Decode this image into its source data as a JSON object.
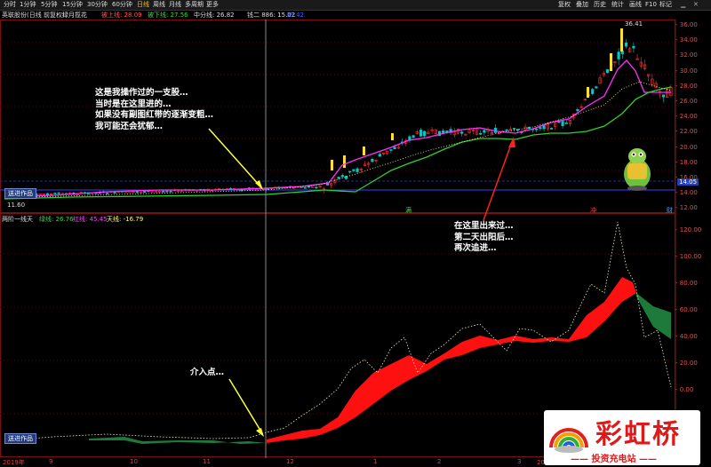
{
  "toolbar": {
    "tabs": [
      "分时",
      "1分钟",
      "5分钟",
      "15分钟",
      "30分钟",
      "60分钟",
      "日线",
      "周线",
      "月线",
      "多周期",
      "更多"
    ],
    "right_buttons": [
      "复权",
      "叠加",
      "历史",
      "统计",
      "画线",
      "F10",
      "标记"
    ]
  },
  "infobar": {
    "stock_name": "英联股份(日线 前复权)",
    "indicator_name": "绿月揽花",
    "up_label": "被上线: 28.09",
    "down_label": "被下线: 27.56",
    "mid_label": "中分线: 26.82",
    "extra_label": "钱二 886: 15.02",
    "extra_value": "39.42"
  },
  "main_chart": {
    "axis": [
      "36.00",
      "34.00",
      "32.00",
      "30.00",
      "28.00",
      "26.00",
      "24.00",
      "22.00",
      "20.00",
      "18.00",
      "16.00",
      "14.00",
      "12.00"
    ],
    "high_label": "36.41",
    "low_label": "11.60",
    "price_tag": "14.05"
  },
  "sub_chart": {
    "name": "两阶一线天",
    "green_label": "绿线: 26.76",
    "red_label": "红线: 45.45",
    "sky_label": "天线: -16.79",
    "axis": [
      "120.00",
      "100.00",
      "80.00",
      "60.00",
      "40.00",
      "20.00",
      "0.00",
      "-20.00"
    ]
  },
  "annotations": {
    "op1": "这是我操作过的一支股…",
    "op2": "当时是在这里进的…",
    "op3": "如果没有副图红带的逐渐变粗…",
    "op4": "我可能还会犹郁…",
    "rt1": "在这里出来过…",
    "rt2": "第二天出阳后…",
    "rt3": "再次追进…",
    "entry": "介入点…"
  },
  "badges": {
    "top": "送进作品",
    "bottom": "送进作品"
  },
  "xaxis": [
    "2019年",
    "9",
    "10",
    "11",
    "12",
    "1",
    "2",
    "3",
    "2020年"
  ],
  "markers": {
    "m1": "满",
    "m2": "冲",
    "m3": "财"
  },
  "logo": {
    "brand": "彩虹桥",
    "tagline": "—— 投资充电站 ——"
  },
  "colors": {
    "up": "#ff3030",
    "down": "#00c0c0",
    "band_red": "#ff1010",
    "band_green": "#1e7a3a",
    "ma_green": "#30d030",
    "ma_magenta": "#ff30ff"
  }
}
